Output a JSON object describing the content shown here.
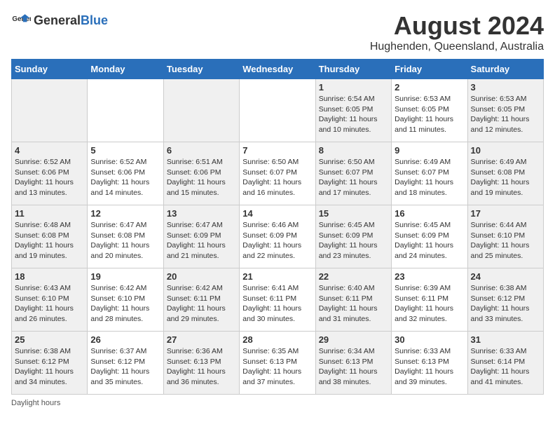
{
  "header": {
    "logo_general": "General",
    "logo_blue": "Blue",
    "month_year": "August 2024",
    "location": "Hughenden, Queensland, Australia"
  },
  "weekdays": [
    "Sunday",
    "Monday",
    "Tuesday",
    "Wednesday",
    "Thursday",
    "Friday",
    "Saturday"
  ],
  "weeks": [
    [
      {
        "day": "",
        "sunrise": "",
        "sunset": "",
        "daylight": ""
      },
      {
        "day": "",
        "sunrise": "",
        "sunset": "",
        "daylight": ""
      },
      {
        "day": "",
        "sunrise": "",
        "sunset": "",
        "daylight": ""
      },
      {
        "day": "",
        "sunrise": "",
        "sunset": "",
        "daylight": ""
      },
      {
        "day": "1",
        "sunrise": "Sunrise: 6:54 AM",
        "sunset": "Sunset: 6:05 PM",
        "daylight": "Daylight: 11 hours and 10 minutes."
      },
      {
        "day": "2",
        "sunrise": "Sunrise: 6:53 AM",
        "sunset": "Sunset: 6:05 PM",
        "daylight": "Daylight: 11 hours and 11 minutes."
      },
      {
        "day": "3",
        "sunrise": "Sunrise: 6:53 AM",
        "sunset": "Sunset: 6:05 PM",
        "daylight": "Daylight: 11 hours and 12 minutes."
      }
    ],
    [
      {
        "day": "4",
        "sunrise": "Sunrise: 6:52 AM",
        "sunset": "Sunset: 6:06 PM",
        "daylight": "Daylight: 11 hours and 13 minutes."
      },
      {
        "day": "5",
        "sunrise": "Sunrise: 6:52 AM",
        "sunset": "Sunset: 6:06 PM",
        "daylight": "Daylight: 11 hours and 14 minutes."
      },
      {
        "day": "6",
        "sunrise": "Sunrise: 6:51 AM",
        "sunset": "Sunset: 6:06 PM",
        "daylight": "Daylight: 11 hours and 15 minutes."
      },
      {
        "day": "7",
        "sunrise": "Sunrise: 6:50 AM",
        "sunset": "Sunset: 6:07 PM",
        "daylight": "Daylight: 11 hours and 16 minutes."
      },
      {
        "day": "8",
        "sunrise": "Sunrise: 6:50 AM",
        "sunset": "Sunset: 6:07 PM",
        "daylight": "Daylight: 11 hours and 17 minutes."
      },
      {
        "day": "9",
        "sunrise": "Sunrise: 6:49 AM",
        "sunset": "Sunset: 6:07 PM",
        "daylight": "Daylight: 11 hours and 18 minutes."
      },
      {
        "day": "10",
        "sunrise": "Sunrise: 6:49 AM",
        "sunset": "Sunset: 6:08 PM",
        "daylight": "Daylight: 11 hours and 19 minutes."
      }
    ],
    [
      {
        "day": "11",
        "sunrise": "Sunrise: 6:48 AM",
        "sunset": "Sunset: 6:08 PM",
        "daylight": "Daylight: 11 hours and 19 minutes."
      },
      {
        "day": "12",
        "sunrise": "Sunrise: 6:47 AM",
        "sunset": "Sunset: 6:08 PM",
        "daylight": "Daylight: 11 hours and 20 minutes."
      },
      {
        "day": "13",
        "sunrise": "Sunrise: 6:47 AM",
        "sunset": "Sunset: 6:09 PM",
        "daylight": "Daylight: 11 hours and 21 minutes."
      },
      {
        "day": "14",
        "sunrise": "Sunrise: 6:46 AM",
        "sunset": "Sunset: 6:09 PM",
        "daylight": "Daylight: 11 hours and 22 minutes."
      },
      {
        "day": "15",
        "sunrise": "Sunrise: 6:45 AM",
        "sunset": "Sunset: 6:09 PM",
        "daylight": "Daylight: 11 hours and 23 minutes."
      },
      {
        "day": "16",
        "sunrise": "Sunrise: 6:45 AM",
        "sunset": "Sunset: 6:09 PM",
        "daylight": "Daylight: 11 hours and 24 minutes."
      },
      {
        "day": "17",
        "sunrise": "Sunrise: 6:44 AM",
        "sunset": "Sunset: 6:10 PM",
        "daylight": "Daylight: 11 hours and 25 minutes."
      }
    ],
    [
      {
        "day": "18",
        "sunrise": "Sunrise: 6:43 AM",
        "sunset": "Sunset: 6:10 PM",
        "daylight": "Daylight: 11 hours and 26 minutes."
      },
      {
        "day": "19",
        "sunrise": "Sunrise: 6:42 AM",
        "sunset": "Sunset: 6:10 PM",
        "daylight": "Daylight: 11 hours and 28 minutes."
      },
      {
        "day": "20",
        "sunrise": "Sunrise: 6:42 AM",
        "sunset": "Sunset: 6:11 PM",
        "daylight": "Daylight: 11 hours and 29 minutes."
      },
      {
        "day": "21",
        "sunrise": "Sunrise: 6:41 AM",
        "sunset": "Sunset: 6:11 PM",
        "daylight": "Daylight: 11 hours and 30 minutes."
      },
      {
        "day": "22",
        "sunrise": "Sunrise: 6:40 AM",
        "sunset": "Sunset: 6:11 PM",
        "daylight": "Daylight: 11 hours and 31 minutes."
      },
      {
        "day": "23",
        "sunrise": "Sunrise: 6:39 AM",
        "sunset": "Sunset: 6:11 PM",
        "daylight": "Daylight: 11 hours and 32 minutes."
      },
      {
        "day": "24",
        "sunrise": "Sunrise: 6:38 AM",
        "sunset": "Sunset: 6:12 PM",
        "daylight": "Daylight: 11 hours and 33 minutes."
      }
    ],
    [
      {
        "day": "25",
        "sunrise": "Sunrise: 6:38 AM",
        "sunset": "Sunset: 6:12 PM",
        "daylight": "Daylight: 11 hours and 34 minutes."
      },
      {
        "day": "26",
        "sunrise": "Sunrise: 6:37 AM",
        "sunset": "Sunset: 6:12 PM",
        "daylight": "Daylight: 11 hours and 35 minutes."
      },
      {
        "day": "27",
        "sunrise": "Sunrise: 6:36 AM",
        "sunset": "Sunset: 6:13 PM",
        "daylight": "Daylight: 11 hours and 36 minutes."
      },
      {
        "day": "28",
        "sunrise": "Sunrise: 6:35 AM",
        "sunset": "Sunset: 6:13 PM",
        "daylight": "Daylight: 11 hours and 37 minutes."
      },
      {
        "day": "29",
        "sunrise": "Sunrise: 6:34 AM",
        "sunset": "Sunset: 6:13 PM",
        "daylight": "Daylight: 11 hours and 38 minutes."
      },
      {
        "day": "30",
        "sunrise": "Sunrise: 6:33 AM",
        "sunset": "Sunset: 6:13 PM",
        "daylight": "Daylight: 11 hours and 39 minutes."
      },
      {
        "day": "31",
        "sunrise": "Sunrise: 6:33 AM",
        "sunset": "Sunset: 6:14 PM",
        "daylight": "Daylight: 11 hours and 41 minutes."
      }
    ]
  ],
  "footer": {
    "note": "Daylight hours"
  }
}
